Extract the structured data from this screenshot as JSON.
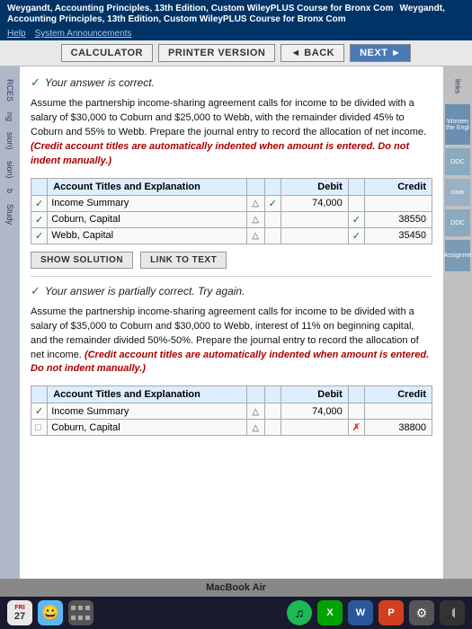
{
  "header": {
    "title": "Weygandt, Accounting Principles, 13th Edition, Custom WileyPLUS Course for Bronx Com",
    "links": [
      "Help",
      "System Announcements"
    ]
  },
  "toolbar": {
    "calculator_label": "CALCULATOR",
    "printer_label": "PRINTER VERSION",
    "back_label": "◄ BACK",
    "next_label": "NEXT ►"
  },
  "left_sidebar": {
    "items": [
      "RCES",
      "ng",
      "sion)",
      "sion)",
      "b",
      "Study"
    ]
  },
  "answer1": {
    "text": "Your answer is correct."
  },
  "problem1": {
    "text": "Assume the partnership income-sharing agreement calls for income to be divided with a salary of $30,000 to Coburn and $25,000 to Webb, with the remainder divided 45% to Coburn and 55% to Webb. Prepare the journal entry to record the allocation of net income.",
    "italic_text": "(Credit account titles are automatically indented when amount is entered. Do not indent manually.)"
  },
  "table1": {
    "col_account": "Account Titles and Explanation",
    "col_debit": "Debit",
    "col_credit": "Credit",
    "rows": [
      {
        "account": "Income Summary",
        "debit": "74,000",
        "credit": "",
        "indent": false
      },
      {
        "account": "Coburn, Capital",
        "debit": "",
        "credit": "38550",
        "indent": false
      },
      {
        "account": "Webb, Capital",
        "debit": "",
        "credit": "35450",
        "indent": false
      }
    ]
  },
  "buttons1": {
    "show_solution": "SHOW SOLUTION",
    "link_to_text": "LINK TO TEXT"
  },
  "answer2": {
    "text": "Your answer is partially correct.  Try again."
  },
  "problem2": {
    "text": "Assume the partnership income-sharing agreement calls for income to be divided with a salary of $35,000 to Coburn and $30,000 to Webb, interest of 11% on beginning capital, and the remainder divided 50%-50%. Prepare the journal entry to record the allocation of net income.",
    "italic_text": "(Credit account titles are automatically indented when amount is entered. Do not indent manually.)"
  },
  "table2": {
    "col_account": "Account Titles and Explanation",
    "col_debit": "Debit",
    "col_credit": "Credit",
    "rows": [
      {
        "account": "Income Summary",
        "debit": "74,000",
        "credit": "",
        "indent": false
      },
      {
        "account": "Coburn, Capital",
        "debit": "",
        "credit": "38800",
        "indent": false
      }
    ]
  },
  "right_decor": {
    "items": [
      "links",
      "Women the Engl",
      "DOC",
      "cinar",
      "DOC",
      "Assignme"
    ]
  },
  "taskbar": {
    "date": "27",
    "month": "FRI"
  },
  "macbook": {
    "label": "MacBook Air"
  }
}
